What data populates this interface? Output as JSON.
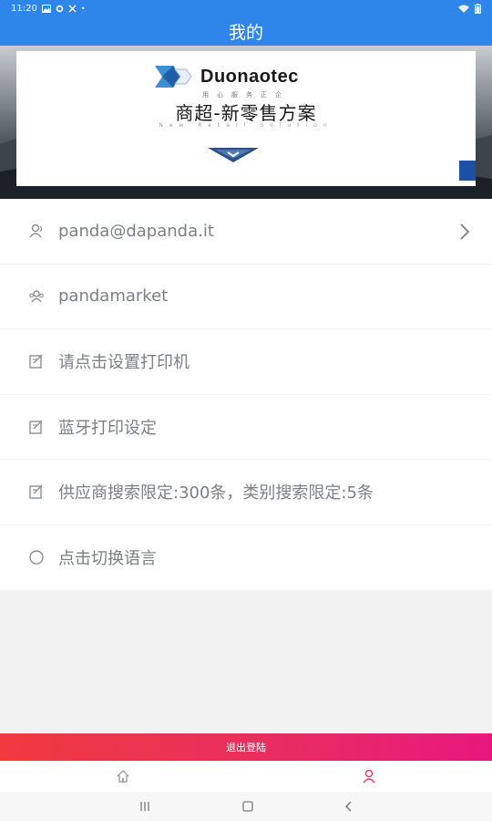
{
  "status": {
    "time": "11:20"
  },
  "header": {
    "title": "我的"
  },
  "banner": {
    "logo_name": "Duonaotec",
    "slogan_small": "用心服务正企",
    "slogan_cn": "商超-新零售方案",
    "slogan_en": "New Retail Solution"
  },
  "menu": {
    "items": [
      {
        "label": "panda@dapanda.it",
        "icon": "user-icon"
      },
      {
        "label": "pandamarket",
        "icon": "group-icon"
      },
      {
        "label": "请点击设置打印机",
        "icon": "edit-icon"
      },
      {
        "label": "蓝牙打印设定",
        "icon": "edit-icon"
      },
      {
        "label": "供应商搜索限定:300条，类别搜索限定:5条",
        "icon": "edit-icon"
      },
      {
        "label": "点击切换语言",
        "icon": "circle-icon"
      }
    ]
  },
  "logout": {
    "label": "退出登陆"
  },
  "colors": {
    "header": "#2f86ea",
    "logout_start": "#f03a3e",
    "logout_end": "#e8177e",
    "active_tab": "#e8356a"
  }
}
